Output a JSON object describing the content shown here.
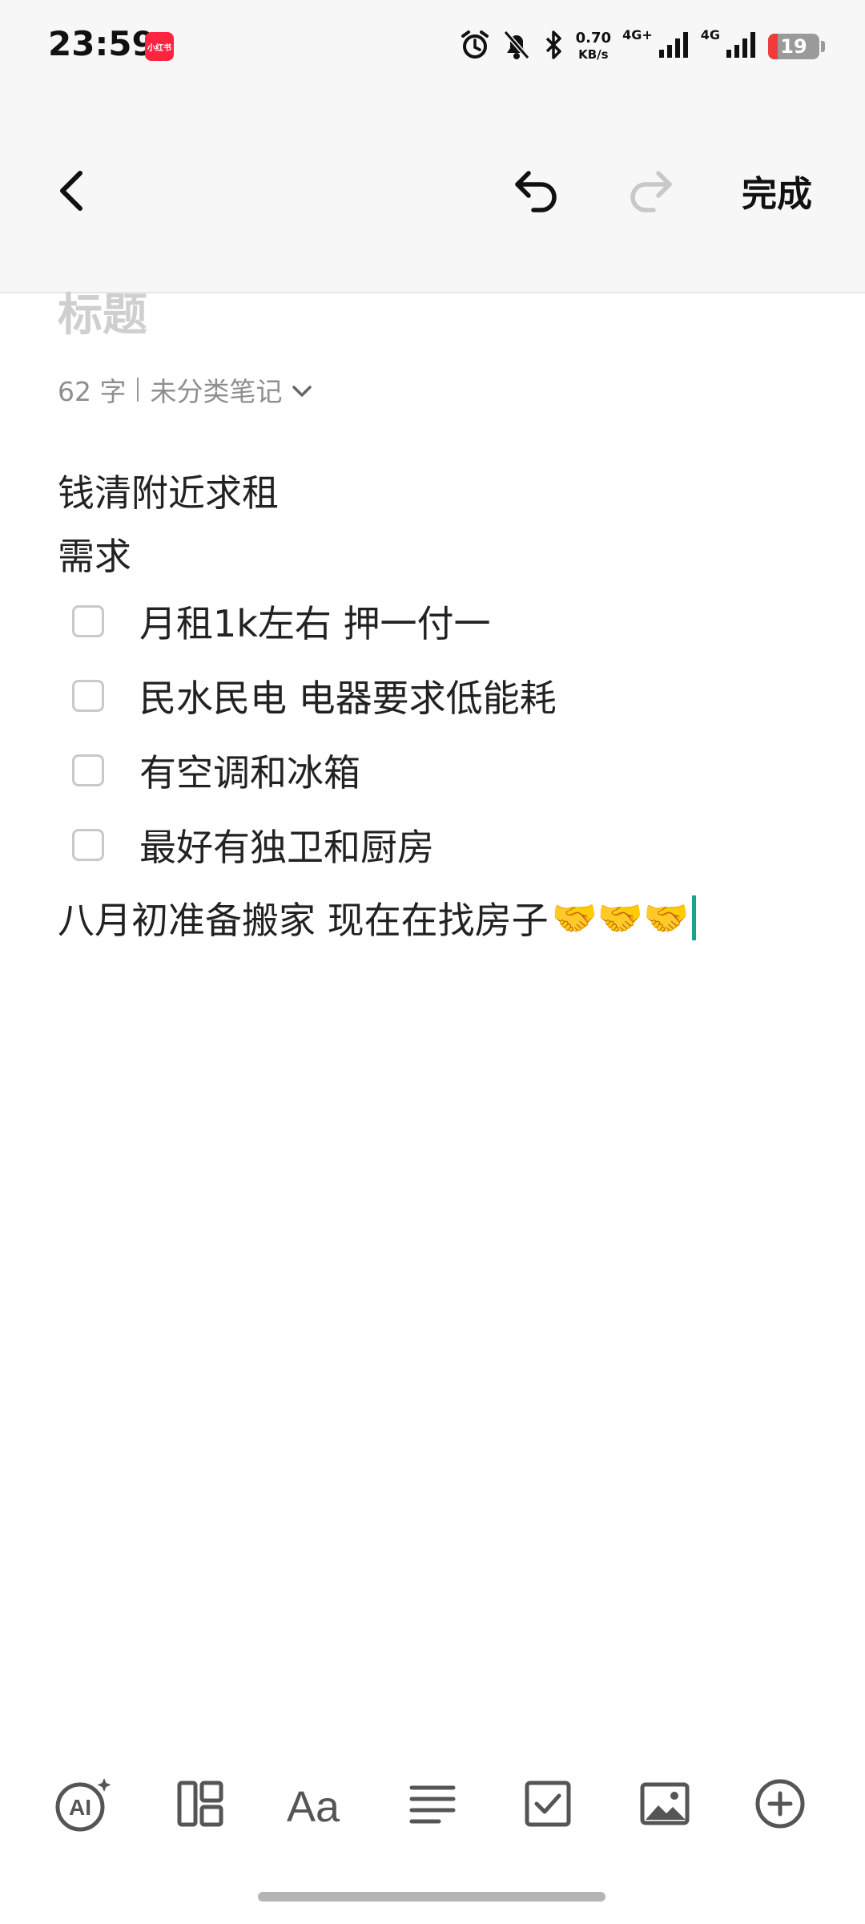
{
  "status_bar": {
    "time": "23:59",
    "app_badge": "小红书",
    "net_speed_value": "0.70",
    "net_speed_unit": "KB/s",
    "net1": "4G+",
    "net2": "4G",
    "battery": "19",
    "icons": [
      "alarm-icon",
      "bell-off-icon",
      "bluetooth-icon",
      "signal-icon",
      "battery-icon"
    ]
  },
  "toolbar": {
    "back_icon": "chevron-left-icon",
    "undo_icon": "undo-icon",
    "redo_icon": "redo-icon",
    "done_label": "完成"
  },
  "note": {
    "title_placeholder": "标题",
    "word_count": "62 字",
    "category": "未分类笔记",
    "lines": [
      "钱清附近求租",
      "需求"
    ],
    "checklist": [
      {
        "text": "月租1k左右  押一付一",
        "checked": false
      },
      {
        "text": "民水民电   电器要求低能耗",
        "checked": false
      },
      {
        "text": "有空调和冰箱",
        "checked": false
      },
      {
        "text": "最好有独卫和厨房",
        "checked": false
      }
    ],
    "last_line": "八月初准备搬家  现在在找房子",
    "emojis": "🤝🤝🤝"
  },
  "bottom_toolbar": {
    "icons": [
      "ai-icon",
      "layout-icon",
      "font-icon",
      "align-icon",
      "checkbox-icon",
      "image-icon",
      "add-icon"
    ]
  },
  "colors": {
    "accent_cursor": "#1aa38a",
    "badge_red": "#ff2442",
    "battery_low": "#ef3b3b"
  }
}
